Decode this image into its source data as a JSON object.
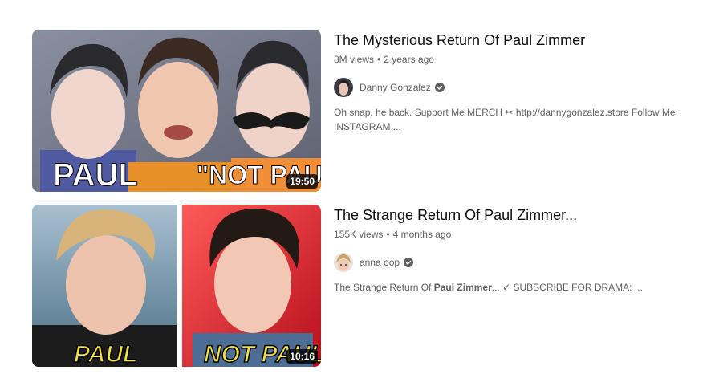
{
  "results": [
    {
      "title": "The Mysterious Return Of Paul Zimmer",
      "views": "8M views",
      "age": "2 years ago",
      "channel": "Danny Gonzalez",
      "verified": true,
      "description": "Oh snap, he back. Support Me MERCH ✂ http://dannygonzalez.store Follow Me INSTAGRAM ...",
      "duration": "19:50",
      "thumb_text_left": "PAUL",
      "thumb_text_right": "\"NOT PAUL\""
    },
    {
      "title": "The Strange Return Of Paul Zimmer...",
      "views": "155K views",
      "age": "4 months ago",
      "channel": "anna oop",
      "verified": true,
      "description_prefix": "The Strange Return Of ",
      "description_bold": "Paul Zimmer",
      "description_suffix": "... ✓ SUBSCRIBE FOR DRAMA: ...",
      "duration": "10:16",
      "thumb_text_left": "PAUL",
      "thumb_text_right": "NOT PAUL"
    }
  ],
  "separator": "•"
}
